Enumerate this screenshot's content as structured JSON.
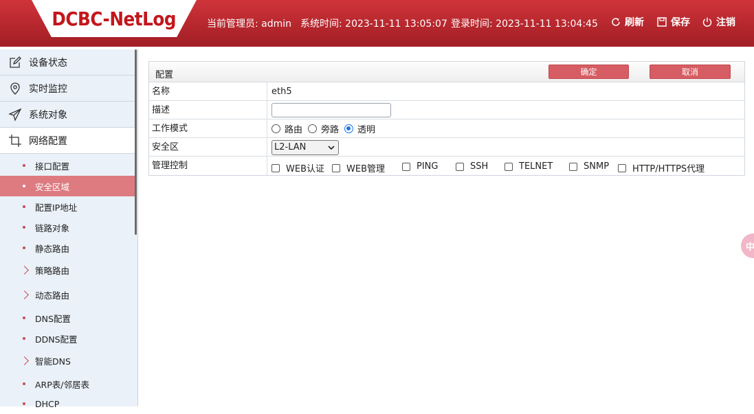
{
  "header": {
    "logo": "DCBC-NetLog",
    "admin": "当前管理员: admin",
    "system_time": "系统时间: 2023-11-11 13:05:07",
    "login_time": "登录时间: 2023-11-11 13:04:45",
    "refresh": "刷新",
    "save": "保存",
    "logout": "注销"
  },
  "sidebar": {
    "menus": [
      {
        "label": "设备状态",
        "icon": "edit-icon"
      },
      {
        "label": "实时监控",
        "icon": "location-pin-icon"
      },
      {
        "label": "系统对象",
        "icon": "send-icon"
      },
      {
        "label": "网络配置",
        "icon": "crop-icon"
      }
    ],
    "subitems": [
      {
        "label": "接口配置"
      },
      {
        "label": "安全区域"
      },
      {
        "label": "配置IP地址"
      },
      {
        "label": "链路对象"
      },
      {
        "label": "静态路由"
      },
      {
        "label": "策略路由"
      },
      {
        "label": "动态路由"
      },
      {
        "label": "DNS配置"
      },
      {
        "label": "DDNS配置"
      },
      {
        "label": "智能DNS"
      },
      {
        "label": "ARP表/邻居表"
      },
      {
        "label": "DHCP"
      }
    ]
  },
  "panel": {
    "title": "配置",
    "confirm": "确定",
    "cancel": "取消",
    "rows": {
      "name_label": "名称",
      "name_value": "eth5",
      "desc_label": "描述",
      "desc_value": "",
      "mode_label": "工作模式",
      "mode_options": [
        "路由",
        "旁路",
        "透明"
      ],
      "mode_selected": "透明",
      "zone_label": "安全区",
      "zone_value": "L2-LAN",
      "mgmt_label": "管理控制",
      "mgmt_options": [
        "WEB认证",
        "WEB管理",
        "PING",
        "SSH",
        "TELNET",
        "SNMP",
        "HTTP/HTTPS代理"
      ]
    }
  },
  "float_tab": "中"
}
